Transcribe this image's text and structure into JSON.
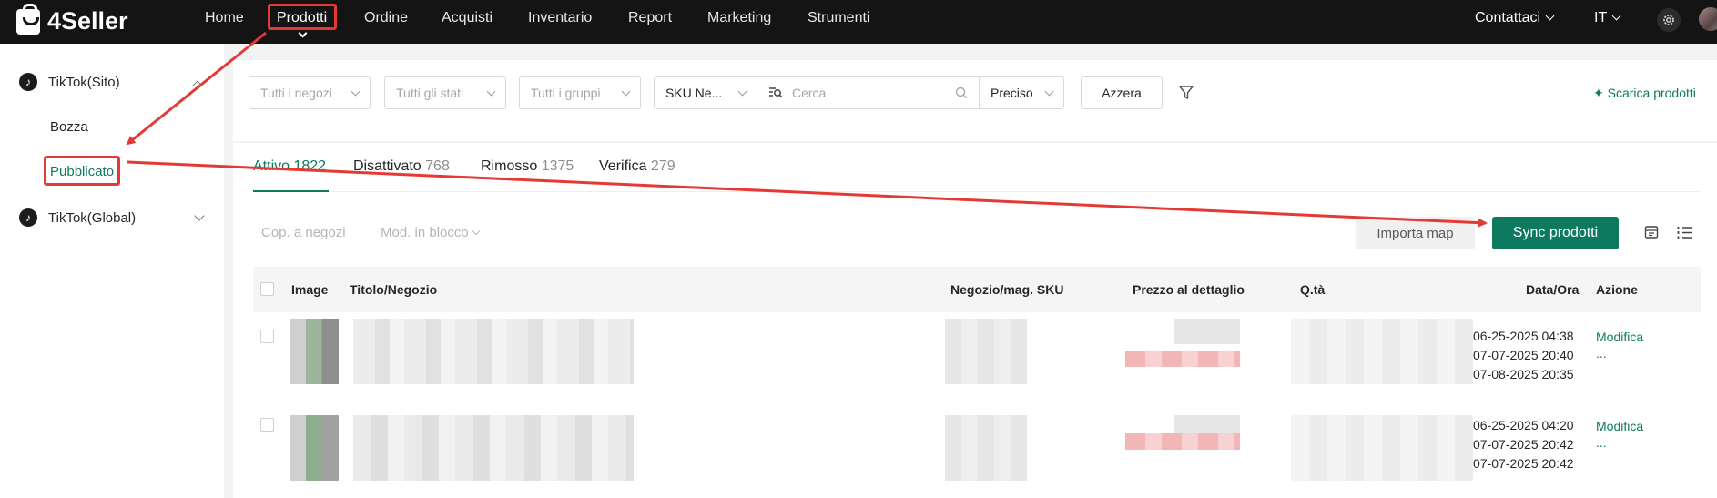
{
  "app": {
    "brand": "4Seller"
  },
  "nav": {
    "items": [
      "Home",
      "Prodotti",
      "Ordine",
      "Acquisti",
      "Inventario",
      "Report",
      "Marketing",
      "Strumenti"
    ],
    "active": "Prodotti",
    "contact": "Contattaci",
    "lang": "IT"
  },
  "sidebar": {
    "groups": [
      {
        "label": "TikTok(Sito)",
        "expanded": true,
        "children": [
          "Bozza",
          "Pubblicato"
        ]
      },
      {
        "label": "TikTok(Global)",
        "expanded": false
      }
    ],
    "active_child": "Pubblicato"
  },
  "filters": {
    "shop_placeholder": "Tutti i negozi",
    "status_placeholder": "Tutti gli stati",
    "group_placeholder": "Tutti i gruppi",
    "search_field": "SKU Ne...",
    "search_placeholder": "Cerca",
    "match_mode": "Preciso",
    "reset_label": "Azzera",
    "download_label": "Scarica prodotti"
  },
  "tabs": [
    {
      "label": "Attivo",
      "count": "1822",
      "active": true
    },
    {
      "label": "Disattivato",
      "count": "768"
    },
    {
      "label": "Rimosso",
      "count": "1375"
    },
    {
      "label": "Verifica",
      "count": "279"
    }
  ],
  "toolbar": {
    "copy_to_shops": "Cop. a negozi",
    "bulk_edit": "Mod. in blocco",
    "import_map": "Importa map",
    "sync_products": "Sync prodotti"
  },
  "table": {
    "columns": [
      "Image",
      "Titolo/Negozio",
      "Negozio/mag. SKU",
      "Prezzo al dettaglio",
      "Q.tà",
      "Data/Ora",
      "Azione"
    ],
    "rows": [
      {
        "dates": [
          "06-25-2025 04:38",
          "07-07-2025 20:40",
          "07-08-2025 20:35"
        ],
        "action": "Modifica",
        "more": "..."
      },
      {
        "dates": [
          "06-25-2025 04:20",
          "07-07-2025 20:42",
          "07-07-2025 20:42"
        ],
        "action": "Modifica",
        "more": "..."
      }
    ]
  },
  "colors": {
    "accent": "#0d7a5f",
    "annotation": "#e53935",
    "topbar": "#141414"
  }
}
